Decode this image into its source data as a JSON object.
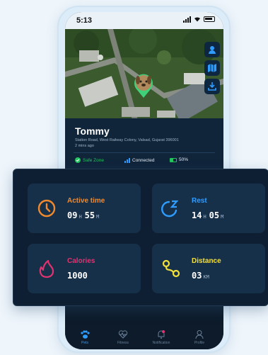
{
  "status": {
    "time": "5:13"
  },
  "pet": {
    "name": "Tommy",
    "address": "Station Road, West Railway Colony, Valsad, Gujarat 396001",
    "updated": "2 mins ago",
    "zone": "Safe Zone",
    "connection": "Connected",
    "battery": "50%",
    "battery_level": 0.5
  },
  "stats": {
    "active_time": {
      "label": "Active time",
      "hours": "09",
      "h_unit": "H",
      "minutes": "55",
      "m_unit": "M"
    },
    "rest": {
      "label": "Rest",
      "hours": "14",
      "h_unit": "H",
      "minutes": "05",
      "m_unit": "M"
    },
    "calories": {
      "label": "Calories",
      "value": "1000"
    },
    "distance": {
      "label": "Distance",
      "value": "03",
      "unit": "KM"
    }
  },
  "tabs": [
    {
      "label": "Pets",
      "icon": "paw-icon"
    },
    {
      "label": "Fitness",
      "icon": "heart-pulse-icon"
    },
    {
      "label": "Notification",
      "icon": "bell-icon"
    },
    {
      "label": "Profile",
      "icon": "user-icon"
    }
  ],
  "colors": {
    "active_time": "#f08a2c",
    "rest": "#2f9cff",
    "calories": "#e0336f",
    "distance": "#f3e03a",
    "safe_zone": "#22c55e",
    "tab_active": "#2f9cff"
  }
}
